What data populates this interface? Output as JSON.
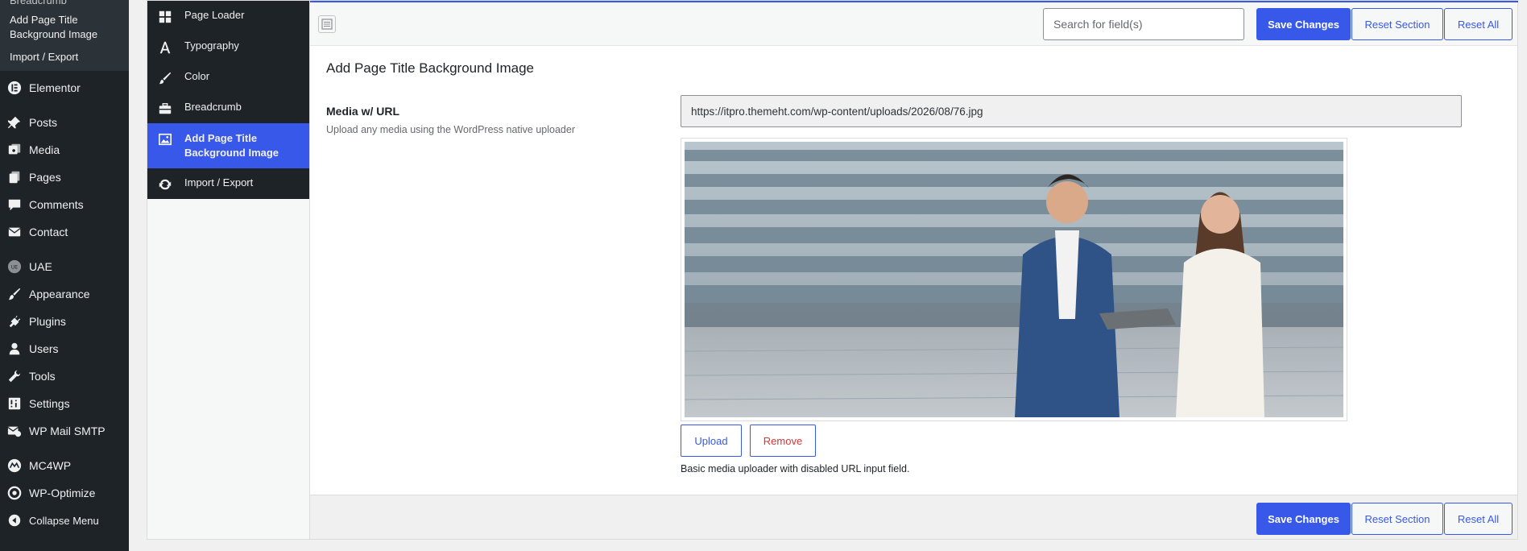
{
  "wp_sidebar": {
    "submenu": {
      "cut_item": "Breadcrumb",
      "items": [
        "Add Page Title\nBackground Image",
        "Import / Export"
      ]
    },
    "menu": [
      {
        "label": "Elementor",
        "icon": "elementor-icon"
      },
      {
        "label": "Posts",
        "icon": "pin-icon"
      },
      {
        "label": "Media",
        "icon": "media-icon"
      },
      {
        "label": "Pages",
        "icon": "pages-icon"
      },
      {
        "label": "Comments",
        "icon": "comment-icon"
      },
      {
        "label": "Contact",
        "icon": "envelope-icon"
      },
      {
        "label": "UAE",
        "icon": "uae-icon"
      },
      {
        "label": "Appearance",
        "icon": "brush-icon"
      },
      {
        "label": "Plugins",
        "icon": "plug-icon"
      },
      {
        "label": "Users",
        "icon": "user-icon"
      },
      {
        "label": "Tools",
        "icon": "wrench-icon"
      },
      {
        "label": "Settings",
        "icon": "settings-icon"
      },
      {
        "label": "WP Mail SMTP",
        "icon": "mail-smtp-icon"
      },
      {
        "label": "MC4WP",
        "icon": "mc4wp-icon"
      },
      {
        "label": "WP-Optimize",
        "icon": "optimize-icon"
      },
      {
        "label": "Collapse Menu",
        "icon": "collapse-icon"
      }
    ]
  },
  "subnav": {
    "items": [
      {
        "label": "Page Loader",
        "icon": "grid-icon"
      },
      {
        "label": "Typography",
        "icon": "typography-icon"
      },
      {
        "label": "Color",
        "icon": "brush-icon"
      },
      {
        "label": "Breadcrumb",
        "icon": "briefcase-icon"
      },
      {
        "label": "Add Page Title Background Image",
        "icon": "image-icon"
      },
      {
        "label": "Import / Export",
        "icon": "refresh-icon"
      }
    ],
    "active_index": 4
  },
  "toolbar": {
    "search_placeholder": "Search for field(s)",
    "save_label": "Save Changes",
    "reset_section_label": "Reset Section",
    "reset_all_label": "Reset All"
  },
  "section": {
    "title": "Add Page Title Background Image",
    "field": {
      "title": "Media w/ URL",
      "description": "Upload any media using the WordPress native uploader",
      "url": "https://itpro.themeht.com/wp-content/uploads/2026/08/76.jpg",
      "upload_label": "Upload",
      "remove_label": "Remove",
      "note": "Basic media uploader with disabled URL input field."
    }
  },
  "colors": {
    "accent": "#3858e9",
    "sidebar_bg": "#1d2327",
    "danger": "#d63638"
  }
}
